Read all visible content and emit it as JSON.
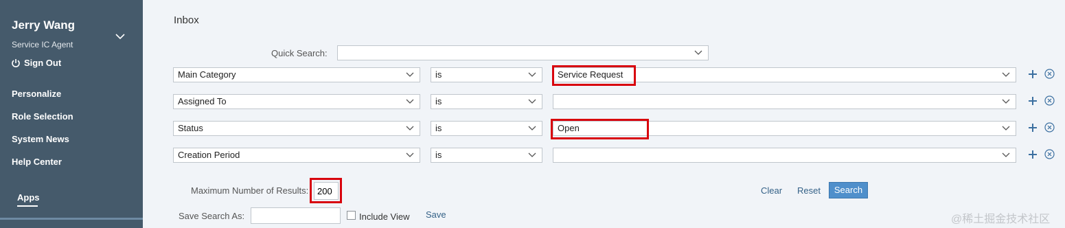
{
  "sidebar": {
    "user_name": "Jerry Wang",
    "user_role": "Service IC Agent",
    "sign_out": "Sign Out",
    "nav": [
      "Personalize",
      "Role Selection",
      "System News",
      "Help Center"
    ],
    "apps_tab": "Apps"
  },
  "page": {
    "title": "Inbox",
    "quick_search_label": "Quick Search:",
    "quick_search_value": ""
  },
  "criteria": [
    {
      "field": "Main Category",
      "operator": "is",
      "value": "Service Request"
    },
    {
      "field": "Assigned To",
      "operator": "is",
      "value": ""
    },
    {
      "field": "Status",
      "operator": "is",
      "value": "Open"
    },
    {
      "field": "Creation Period",
      "operator": "is",
      "value": ""
    }
  ],
  "results": {
    "max_label": "Maximum Number of Results:",
    "max_value": "200"
  },
  "actions": {
    "clear": "Clear",
    "reset": "Reset",
    "search": "Search"
  },
  "save_search": {
    "label": "Save Search As:",
    "value": "",
    "include_view": "Include View",
    "include_view_checked": false,
    "save": "Save"
  },
  "watermark": "@稀土掘金技术社区",
  "colors": {
    "sidebar_bg": "#455a6b",
    "page_bg": "#f1f4f8",
    "highlight": "#d8000c",
    "primary_button": "#4f8fcb",
    "link": "#346187"
  }
}
